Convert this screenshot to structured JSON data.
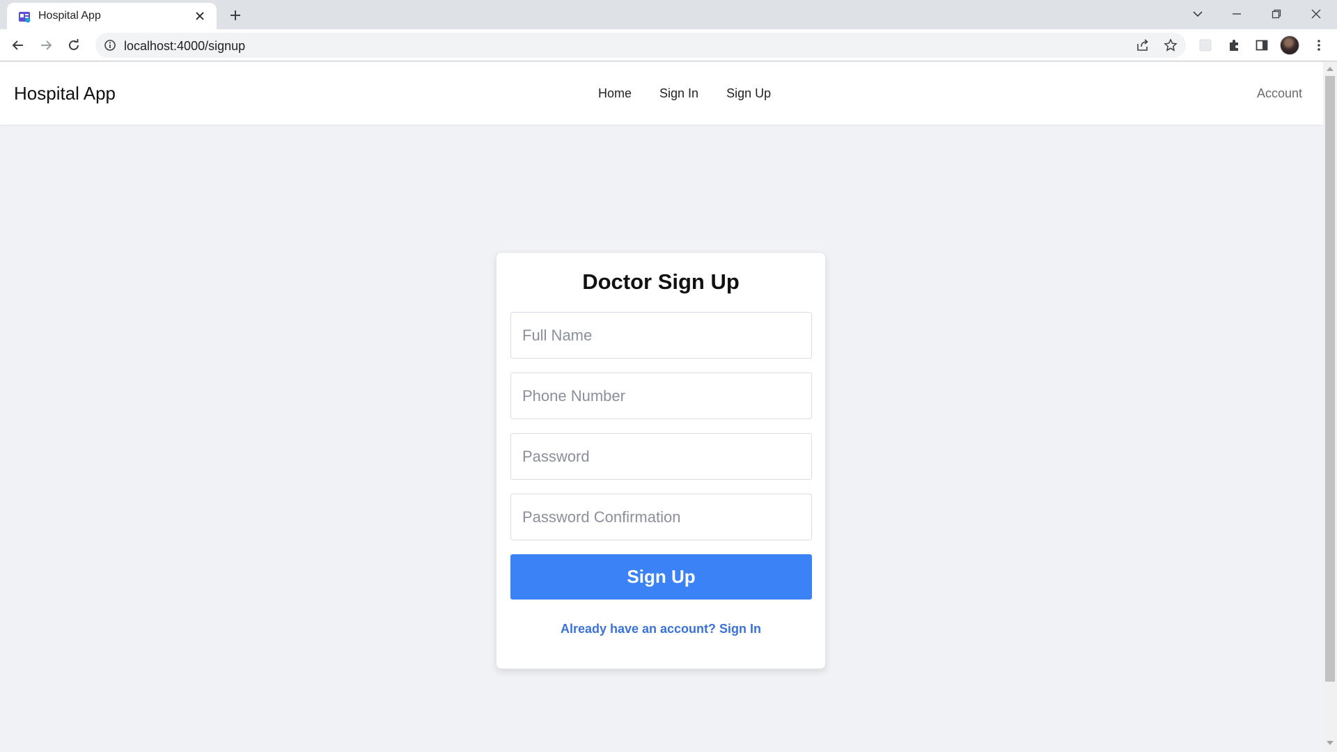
{
  "browser": {
    "tab_title": "Hospital App",
    "url": "localhost:4000/signup"
  },
  "app": {
    "brand": "Hospital App",
    "nav": [
      "Home",
      "Sign In",
      "Sign Up"
    ],
    "account": "Account"
  },
  "form": {
    "title": "Doctor Sign Up",
    "fields": [
      {
        "placeholder": "Full Name",
        "value": ""
      },
      {
        "placeholder": "Phone Number",
        "value": ""
      },
      {
        "placeholder": "Password",
        "value": ""
      },
      {
        "placeholder": "Password Confirmation",
        "value": ""
      }
    ],
    "submit_label": "Sign Up",
    "signin_prompt": "Already have an account? Sign In"
  },
  "colors": {
    "primary": "#3b82f6",
    "link": "#3b72d9",
    "page_background": "#f0f2f5"
  }
}
